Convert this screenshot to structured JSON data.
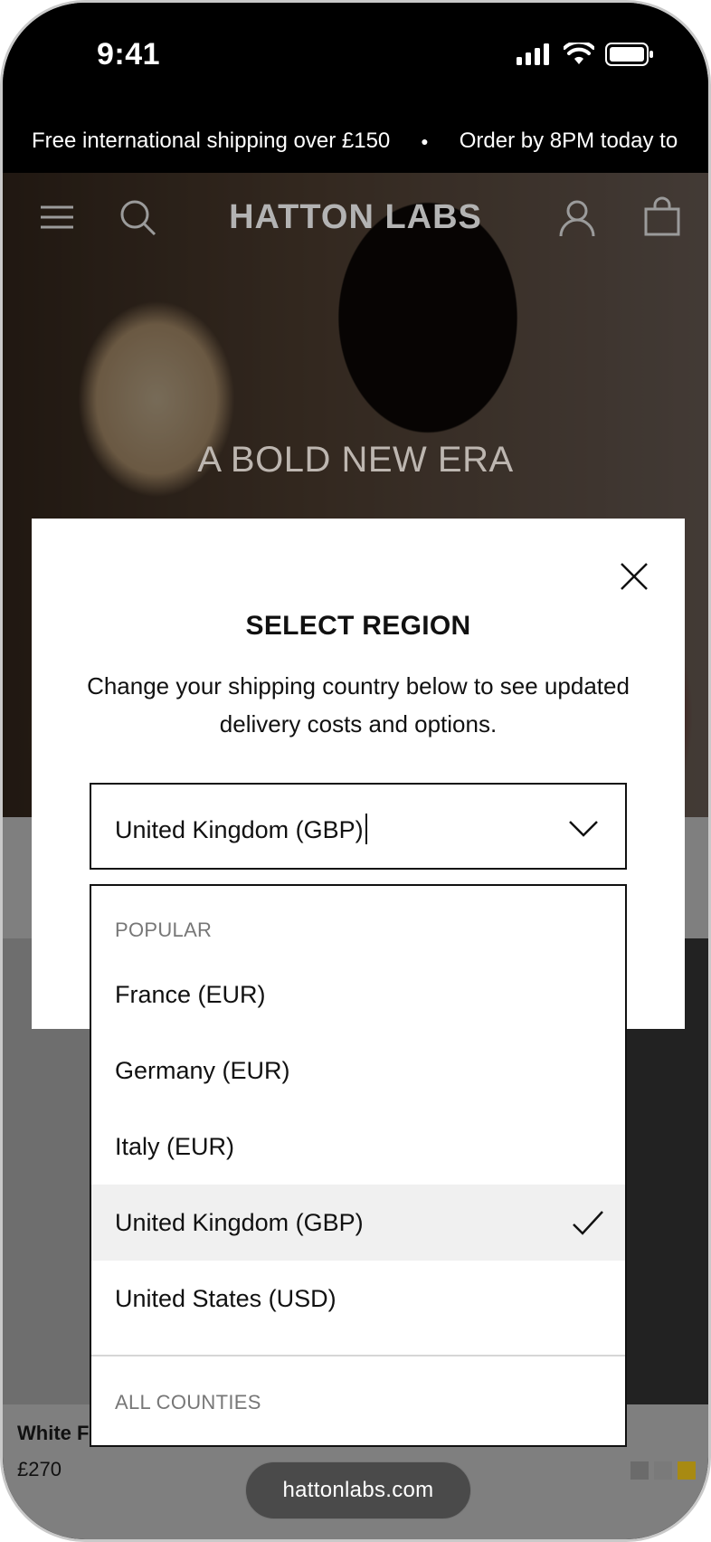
{
  "status_bar": {
    "time": "9:41"
  },
  "announcement": {
    "messages": [
      "Free international shipping over £150",
      "Order by 8PM today to"
    ]
  },
  "header": {
    "brand": "HATTON LABS",
    "icons": [
      "menu-icon",
      "search-icon",
      "account-icon",
      "bag-icon"
    ]
  },
  "hero": {
    "title": "A BOLD NEW ERA"
  },
  "product": {
    "name": "White F",
    "price": "£270",
    "swatch_colors": [
      "#6b6b6b",
      "#7a7a7a",
      "#a88a12"
    ]
  },
  "modal": {
    "title": "SELECT REGION",
    "description": "Change your shipping country below to see updated delivery costs and options.",
    "select_value": "United Kingdom (GBP)",
    "dropdown": {
      "popular_label": "POPULAR",
      "options": [
        {
          "label": "France (EUR)",
          "selected": false
        },
        {
          "label": "Germany (EUR)",
          "selected": false
        },
        {
          "label": "Italy (EUR)",
          "selected": false
        },
        {
          "label": "United Kingdom (GBP)",
          "selected": true
        },
        {
          "label": "United States (USD)",
          "selected": false
        }
      ],
      "all_label": "ALL COUNTIES"
    }
  },
  "browser": {
    "url": "hattonlabs.com"
  },
  "colors": {
    "selected_bg": "#f0f0f0",
    "muted_text": "#777777",
    "swatch_gold": "#a88a12"
  }
}
